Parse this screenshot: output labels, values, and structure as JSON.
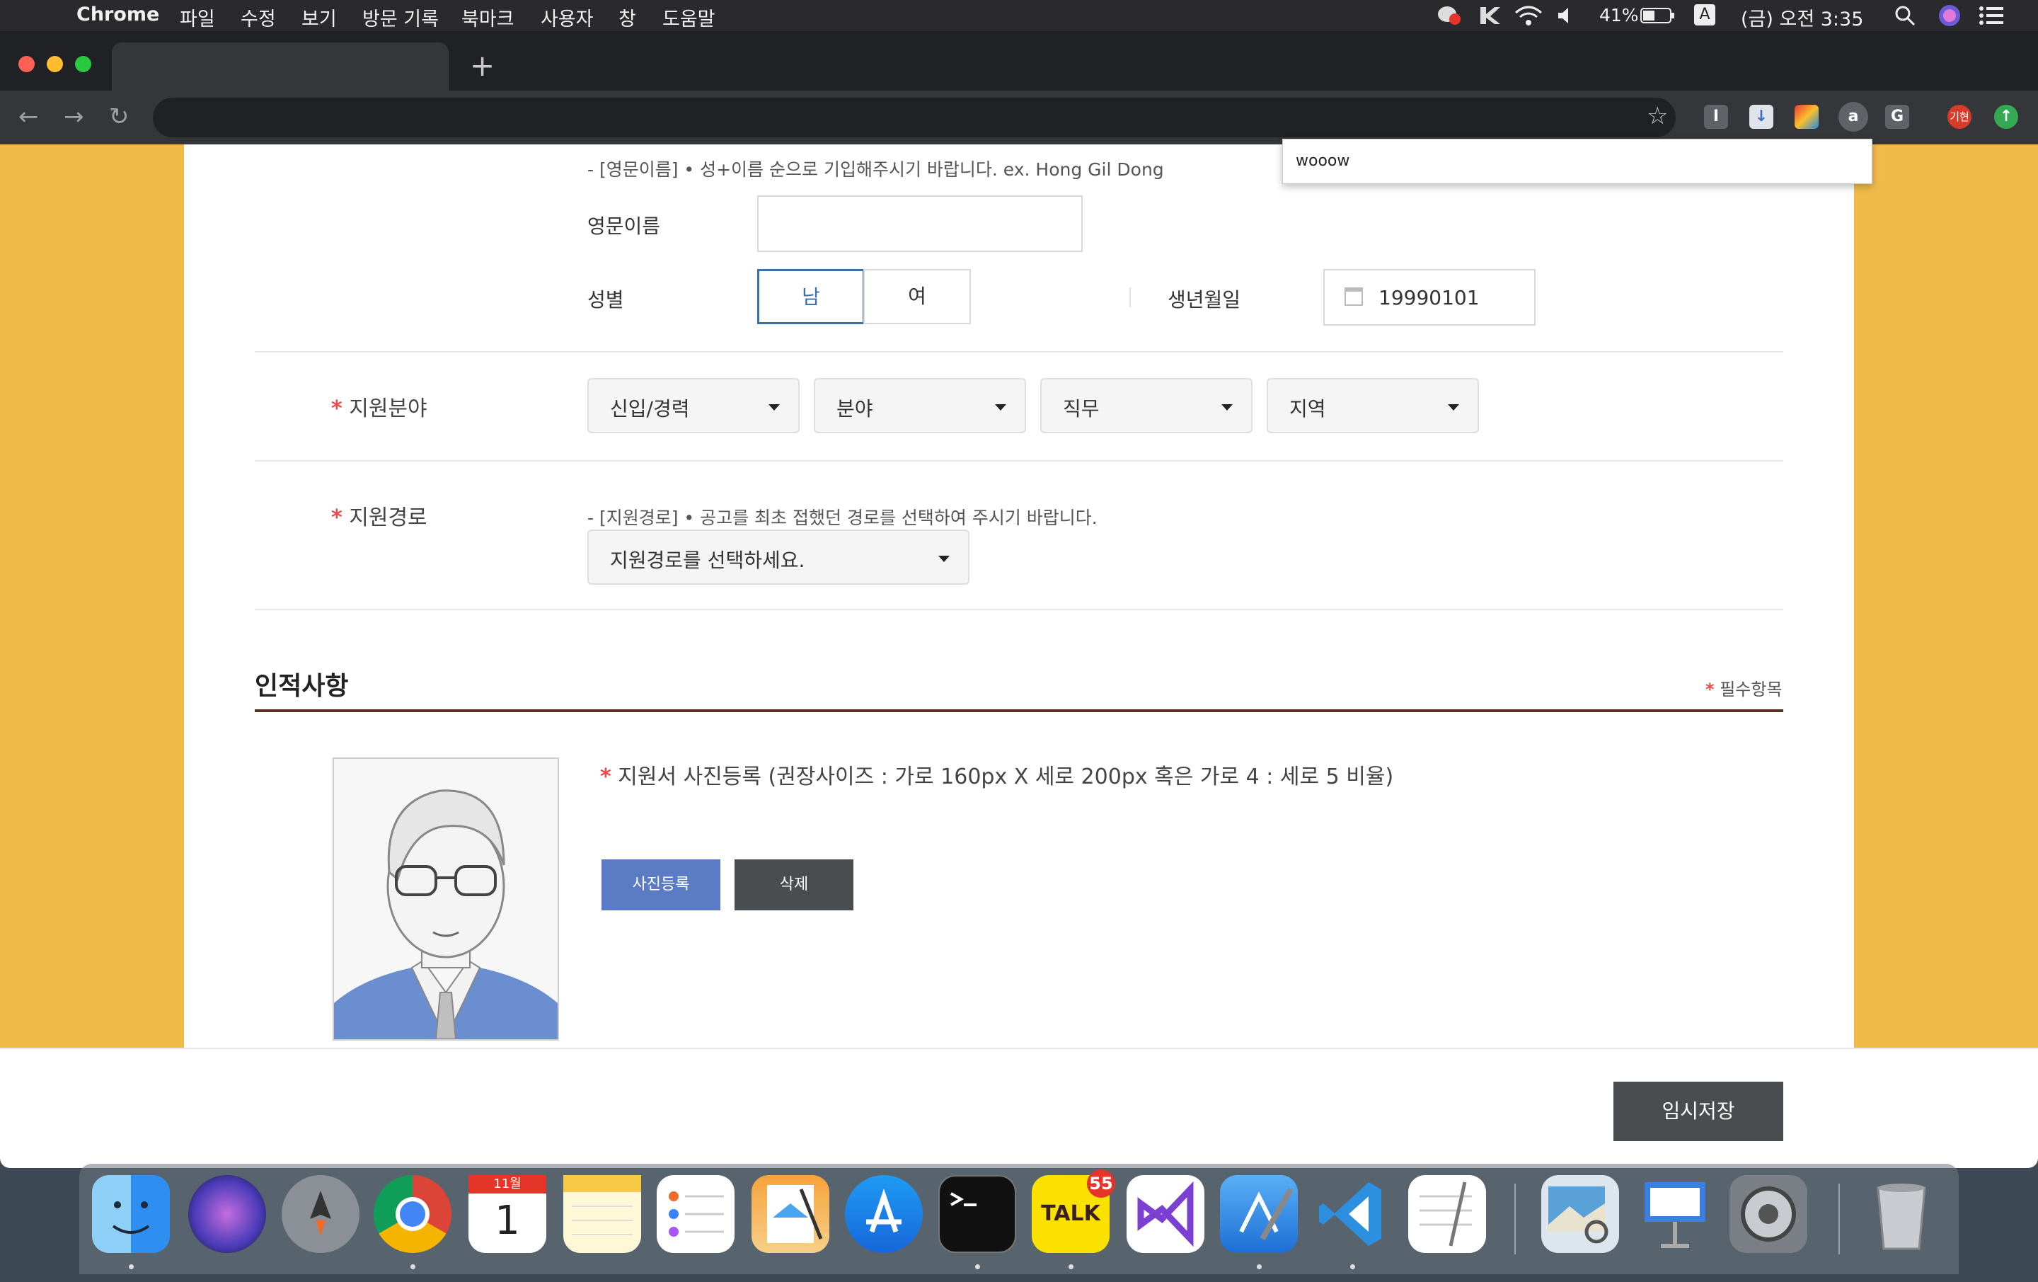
{
  "menubar": {
    "app_name": "Chrome",
    "items": [
      "파일",
      "수정",
      "보기",
      "방문 기록",
      "북마크",
      "사용자",
      "창",
      "도움말"
    ],
    "battery": "41%",
    "input_source": "A",
    "clock": "(금) 오전 3:35"
  },
  "browser": {
    "extensions": [
      "I",
      "↓",
      "",
      "a",
      "G",
      "기현",
      "↑"
    ],
    "popup_text": "wooow"
  },
  "form": {
    "english_name_note": "- [영문이름] • 성+이름 순으로 기입해주시기 바랍니다. ex. Hong Gil Dong",
    "english_name_label": "영문이름",
    "english_name_value": "",
    "gender_label": "성별",
    "gender_male": "남",
    "gender_female": "여",
    "birth_label": "생년월일",
    "birth_value": "19990101",
    "field_label": "지원분야",
    "field_selects": [
      "신입/경력",
      "분야",
      "직무",
      "지역"
    ],
    "route_label": "지원경로",
    "route_note": "- [지원경로] • 공고를 최초 접했던 경로를 선택하여 주시기 바랍니다.",
    "route_select": "지원경로를 선택하세요.",
    "required_mark": "*"
  },
  "personal": {
    "title": "인적사항",
    "required_note": "필수항목",
    "photo_caption": "지원서 사진등록 (권장사이즈 : 가로 160px X 세로 200px 혹은 가로 4 : 세로 5 비율)",
    "upload_button": "사진등록",
    "delete_button": "삭제"
  },
  "footer": {
    "save_button": "임시저장"
  },
  "dock": {
    "calendar_month": "11월",
    "calendar_day": "1",
    "kakao_label": "TALK",
    "kakao_badge": "55"
  },
  "colors": {
    "page_bg": "#f1bb4a",
    "accent_blue": "#3d6ea5",
    "upload_btn": "#5b7cc4",
    "delete_btn": "#4a4d50",
    "required": "#e94b4b"
  }
}
